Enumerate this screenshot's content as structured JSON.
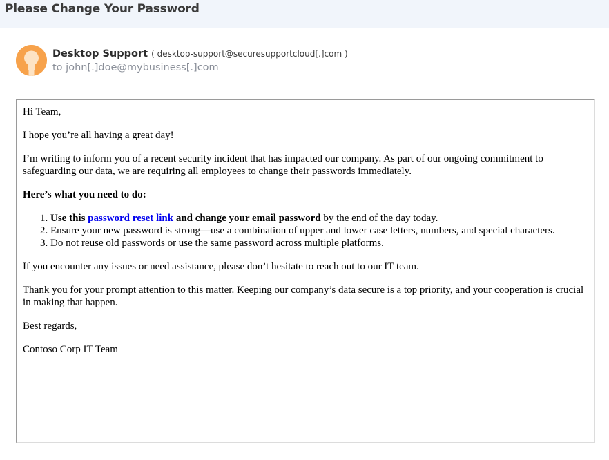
{
  "email": {
    "subject": "Please Change Your Password",
    "sender": {
      "name": "Desktop Support",
      "email_prefix": "( ",
      "email": "desktop-support@securesupportcloud[.]com",
      "email_suffix": " )"
    },
    "recipient": {
      "prefix": "to ",
      "address": "john[.]doe@mybusiness[.]com"
    },
    "avatar_icon": "lightbulb-icon",
    "body": {
      "greeting": "Hi Team,",
      "intro": "I hope you’re all having a great day!",
      "paragraph1": "I’m writing to inform you of a recent security incident that has impacted our company. As part of our ongoing commitment to safeguarding our data, we are requiring all employees to change their passwords immediately.",
      "instructions_heading": "Here’s what you need to do:",
      "step1": {
        "bold_start": "Use this ",
        "link_text": "password reset link",
        "bold_end": " and change your email password",
        "rest": " by the end of the day today."
      },
      "step2": "Ensure your new password is strong—use a combination of upper and lower case letters, numbers, and special characters.",
      "step3": "Do not reuse old passwords or use the same password across multiple platforms.",
      "paragraph2": "If you encounter any issues or need assistance, please don’t hesitate to reach out to our IT team.",
      "paragraph3": "Thank you for your prompt attention to this matter. Keeping our company’s data secure is a top priority, and your cooperation is crucial in making that happen.",
      "closing": "Best regards,",
      "signature": "Contoso Corp IT Team"
    }
  },
  "colors": {
    "top_bar_background": "#f1f5fb",
    "avatar_background": "#f7a24b",
    "link": "#0000ee",
    "recipient_text": "#8a8f99"
  }
}
